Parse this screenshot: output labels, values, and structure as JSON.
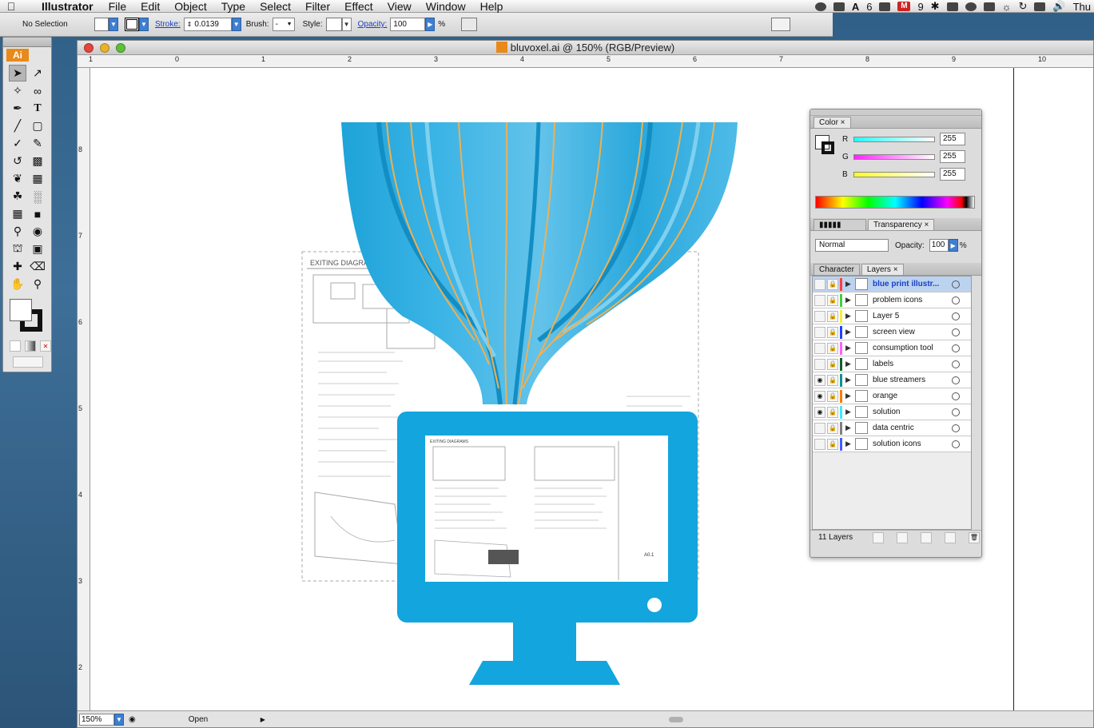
{
  "menubar": {
    "app_name": "Illustrator",
    "items": [
      "File",
      "Edit",
      "Object",
      "Type",
      "Select",
      "Filter",
      "Effect",
      "View",
      "Window",
      "Help"
    ],
    "status_6": "6",
    "mail_count": "9",
    "clock": "Thu"
  },
  "controlbar": {
    "selection": "No Selection",
    "stroke_label": "Stroke:",
    "stroke_value": "0.0139",
    "brush_label": "Brush:",
    "brush_value": "-",
    "style_label": "Style:",
    "opacity_label": "Opacity:",
    "opacity_value": "100",
    "percent": "%"
  },
  "tools": {
    "logo": "Ai"
  },
  "document": {
    "title": "bluvoxel.ai @ 150% (RGB/Preview)",
    "ruler_top": [
      "1",
      "0",
      "1",
      "2",
      "3",
      "4",
      "5",
      "6",
      "7",
      "8",
      "9",
      "10"
    ],
    "ruler_left": [
      "8",
      "7",
      "6",
      "5",
      "4",
      "3",
      "2"
    ],
    "zoom": "150%",
    "status": "Open"
  },
  "artwork": {
    "blueprint_heading": "EXITING DIAGRAMS",
    "screen_heading": "EXITING DIAGRAMS",
    "sheet_id": "A0.1",
    "colors": {
      "blue": "#1aa6dd",
      "orange": "#f0b050",
      "monitor": "#13a5dd"
    }
  },
  "color_panel": {
    "tab": "Color",
    "r_label": "R",
    "r_value": "255",
    "g_label": "G",
    "g_value": "255",
    "b_label": "B",
    "b_value": "255"
  },
  "transparency_panel": {
    "tab": "Transparency",
    "mode": "Normal",
    "opacity_label": "Opacity:",
    "opacity_value": "100",
    "percent": "%"
  },
  "layers_panel": {
    "tab_character": "Character",
    "tab_layers": "Layers",
    "layers": [
      {
        "name": "blue print illustr...",
        "color": "#ff4040",
        "visible": false,
        "selected": true
      },
      {
        "name": "problem icons",
        "color": "#40d040",
        "visible": false,
        "selected": false
      },
      {
        "name": "Layer 5",
        "color": "#f0f040",
        "visible": false,
        "selected": false
      },
      {
        "name": "screen view",
        "color": "#2040ff",
        "visible": false,
        "selected": false
      },
      {
        "name": "consumption tool",
        "color": "#ff60ff",
        "visible": false,
        "selected": false
      },
      {
        "name": "labels",
        "color": "#106030",
        "visible": false,
        "selected": false
      },
      {
        "name": "blue streamers",
        "color": "#109090",
        "visible": true,
        "selected": false
      },
      {
        "name": "orange",
        "color": "#ff7a00",
        "visible": true,
        "selected": false
      },
      {
        "name": "solution",
        "color": "#40e8ff",
        "visible": true,
        "selected": false
      },
      {
        "name": "data centric",
        "color": "#808080",
        "visible": false,
        "selected": false
      },
      {
        "name": "solution icons",
        "color": "#4060ff",
        "visible": false,
        "selected": false
      }
    ],
    "count": "11 Layers"
  }
}
